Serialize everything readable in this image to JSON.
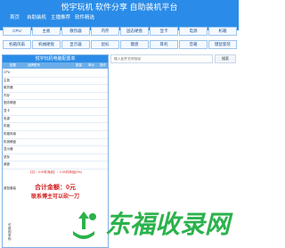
{
  "header": {
    "site_title": "悦宇玩机 软件分享 自助装机平台",
    "nav": [
      "首页",
      "自助装机",
      "主播推荐",
      "软件精选"
    ]
  },
  "categories": {
    "row1": [
      "CPU",
      "主板",
      "散热器",
      "内存",
      "固态硬盘",
      "显卡",
      "电源",
      "机箱"
    ],
    "row2": [
      "机箱风扇",
      "机械硬盘",
      "显示器",
      "鼠标",
      "键盘",
      "耳机",
      "音箱",
      "键鼠套装"
    ]
  },
  "config_panel": {
    "title": "悦宇玩机电脑配置单",
    "columns": [
      "配置",
      "品牌型号",
      "数量",
      "单价",
      "操作"
    ],
    "rows": [
      "CPU",
      "主板",
      "散热器",
      "内存",
      "固态硬盘",
      "显卡",
      "电源",
      "机箱",
      "机箱风扇",
      "机械硬盘",
      "显示器",
      "鼠标",
      "键盘",
      "键鼠套装"
    ],
    "summary": "【共：0.00件商品】：0.00件商品(0%)",
    "total": "合计金额：0元",
    "contact": "联系博主可以砍一刀",
    "side_note": "可能因采购"
  },
  "search": {
    "placeholder": "输入配件名称搜索",
    "button_label": "搜索"
  },
  "watermark": {
    "text": "东福收录网"
  },
  "colors": {
    "header_bg": "#2a8ce8",
    "accent_red": "#d11f1f",
    "watermark_green": "#2bb24c"
  }
}
